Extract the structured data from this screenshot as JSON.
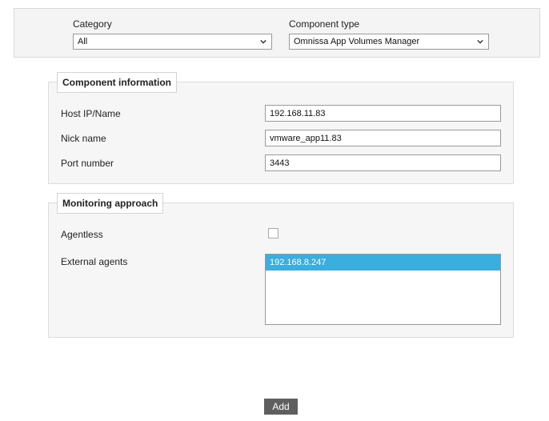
{
  "filters": {
    "category": {
      "label": "Category",
      "value": "All"
    },
    "component_type": {
      "label": "Component type",
      "value": "Omnissa App Volumes Manager"
    }
  },
  "component_info": {
    "title": "Component information",
    "host_ip": {
      "label": "Host IP/Name",
      "value": "192.168.11.83"
    },
    "nick_name": {
      "label": "Nick name",
      "value": "vmware_app11.83"
    },
    "port": {
      "label": "Port number",
      "value": "3443"
    }
  },
  "monitoring": {
    "title": "Monitoring approach",
    "agentless": {
      "label": "Agentless",
      "checked": false
    },
    "external_agents": {
      "label": "External agents",
      "items": [
        "192.168.8.247"
      ],
      "selected": "192.168.8.247"
    }
  },
  "actions": {
    "add_label": "Add"
  },
  "colors": {
    "selection": "#3aaede",
    "button": "#5f5f5f"
  }
}
